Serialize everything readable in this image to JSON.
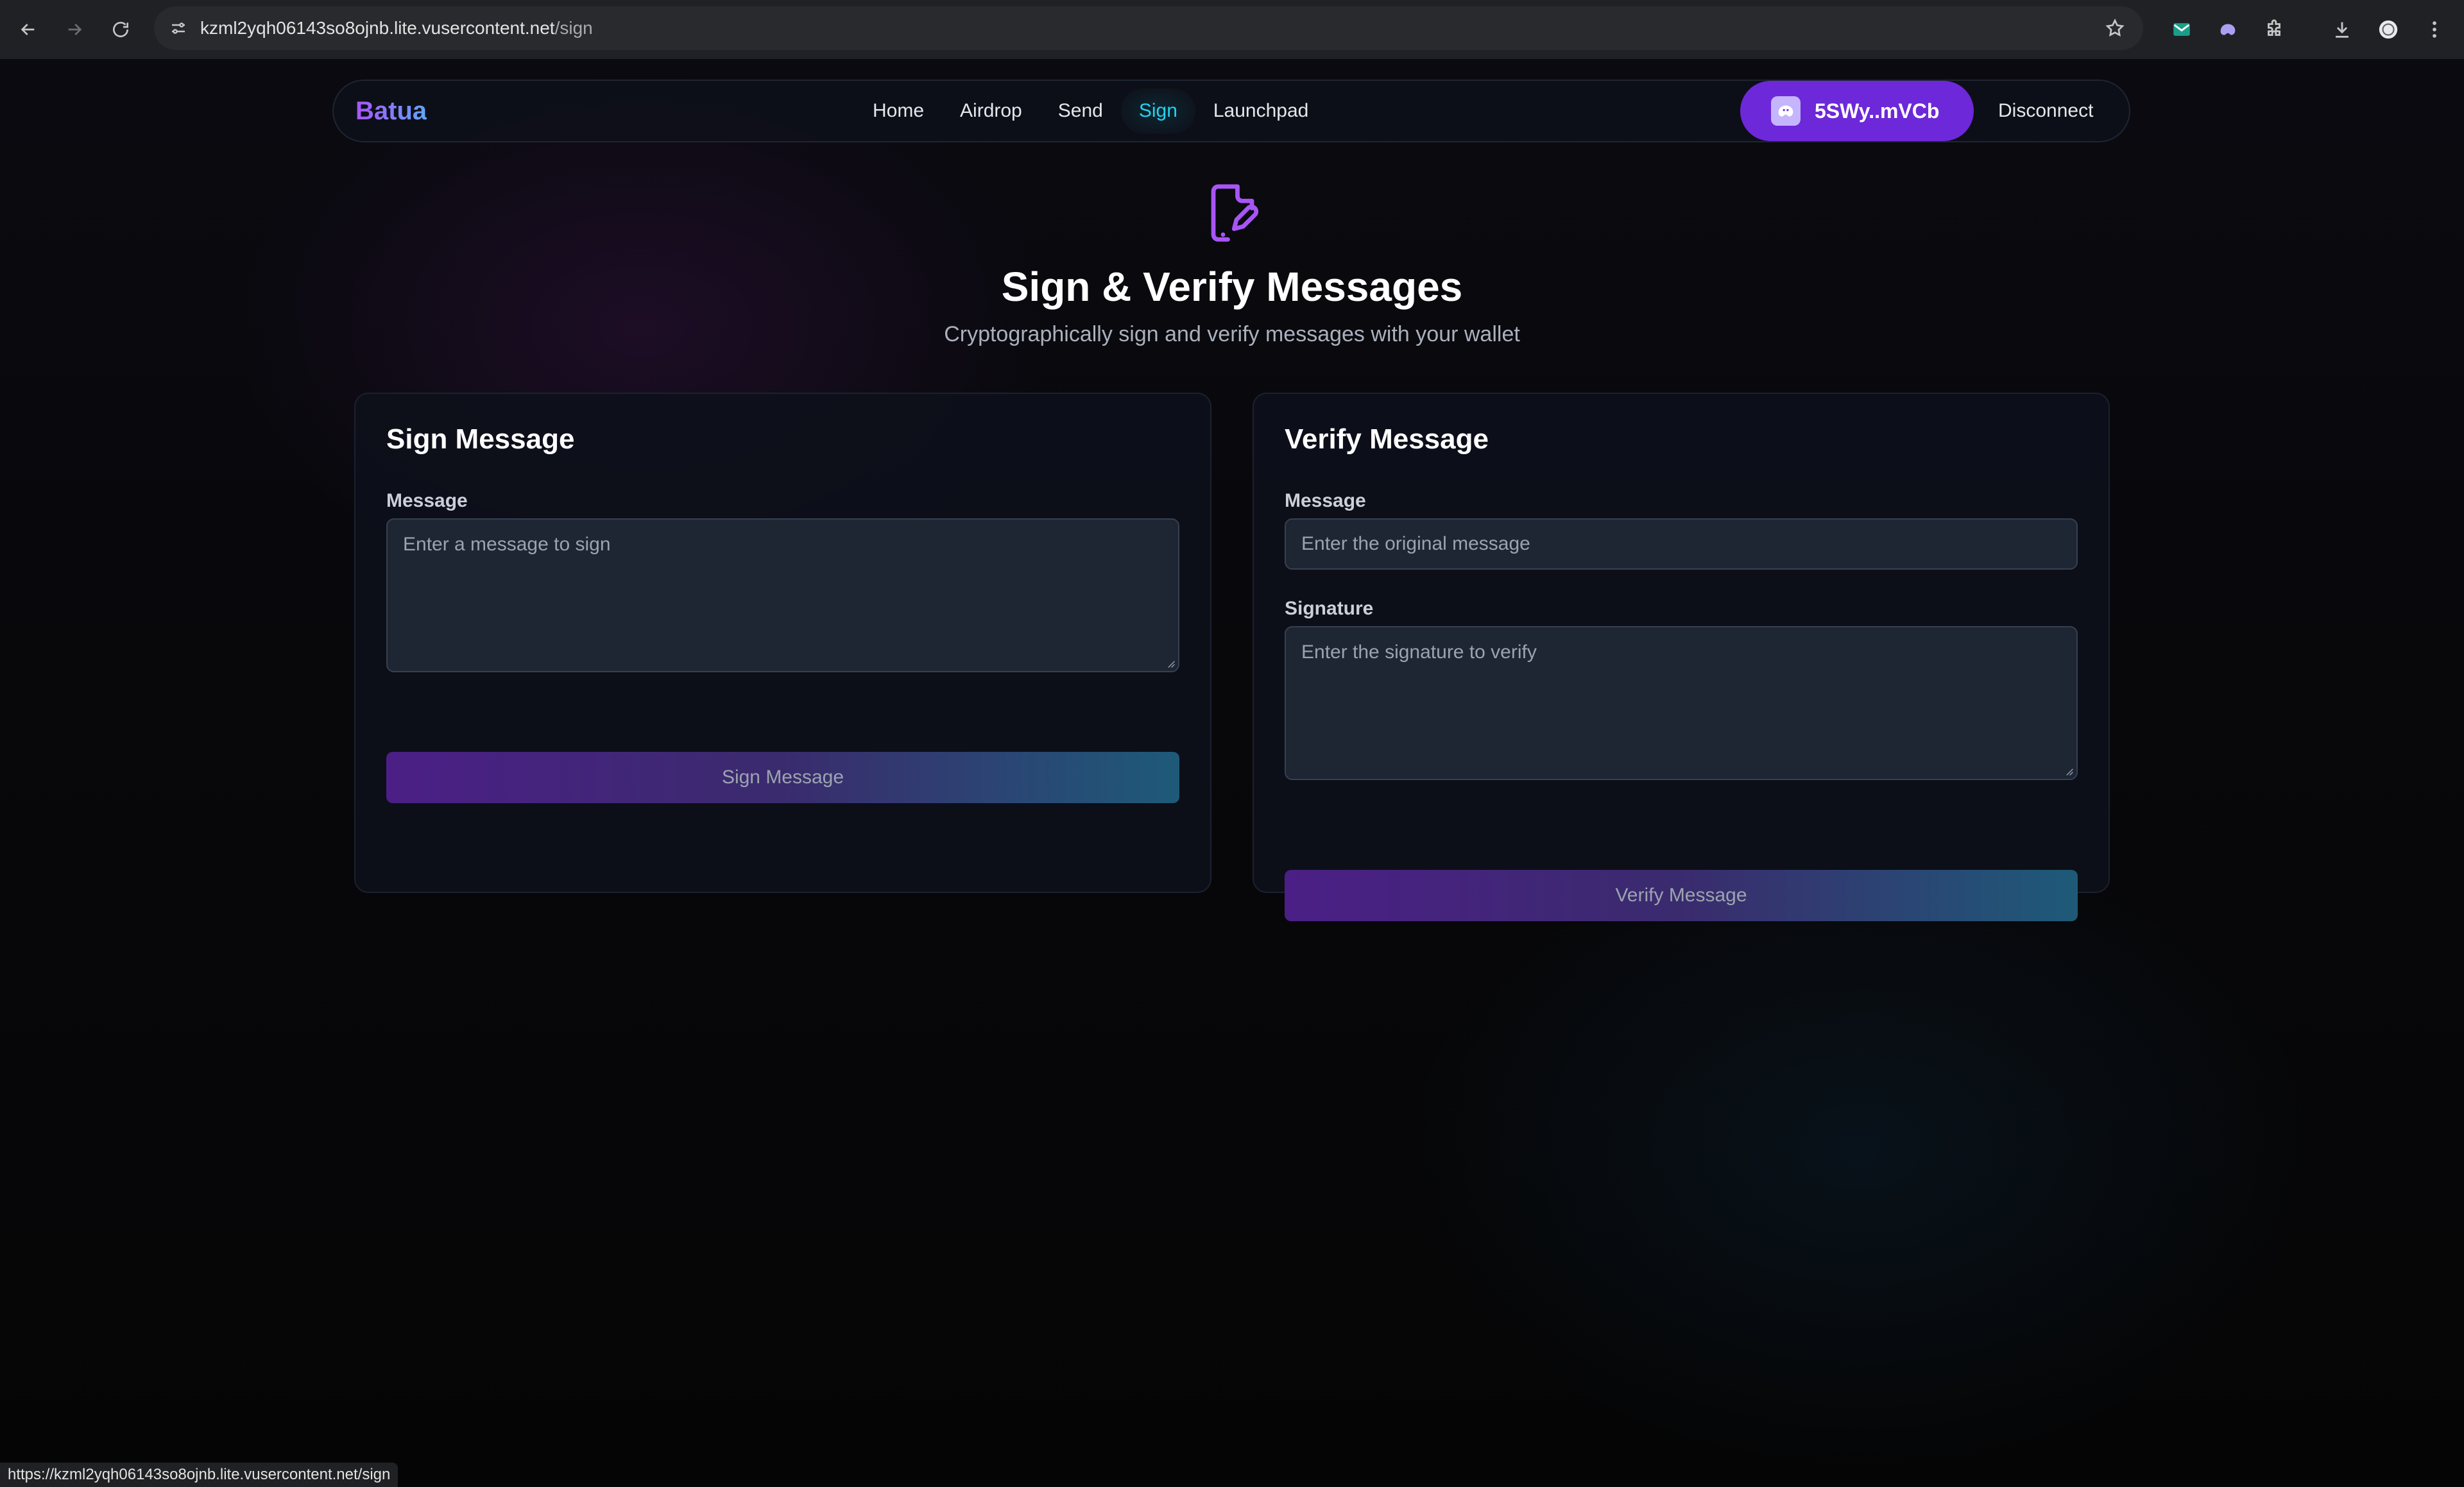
{
  "browser": {
    "url_host": "kzml2yqh06143so8ojnb.lite.vusercontent.net",
    "url_path": "/sign",
    "status_url": "https://kzml2yqh06143so8ojnb.lite.vusercontent.net/sign"
  },
  "navbar": {
    "brand": "Batua",
    "links": [
      {
        "label": "Home"
      },
      {
        "label": "Airdrop"
      },
      {
        "label": "Send"
      },
      {
        "label": "Sign",
        "active": true
      },
      {
        "label": "Launchpad"
      }
    ],
    "wallet_label": "5SWy..mVCb",
    "disconnect_label": "Disconnect"
  },
  "hero": {
    "icon": "file-signature-icon",
    "title": "Sign & Verify Messages",
    "subtitle": "Cryptographically sign and verify messages with your wallet"
  },
  "sign_card": {
    "title": "Sign Message",
    "message_label": "Message",
    "message_placeholder": "Enter a message to sign",
    "button_label": "Sign Message"
  },
  "verify_card": {
    "title": "Verify Message",
    "message_label": "Message",
    "message_placeholder": "Enter the original message",
    "signature_label": "Signature",
    "signature_placeholder": "Enter the signature to verify",
    "button_label": "Verify Message"
  },
  "colors": {
    "accent_purple": "#a855f7",
    "active_link": "#22d3ee",
    "wallet_button": "#6d28d9"
  }
}
